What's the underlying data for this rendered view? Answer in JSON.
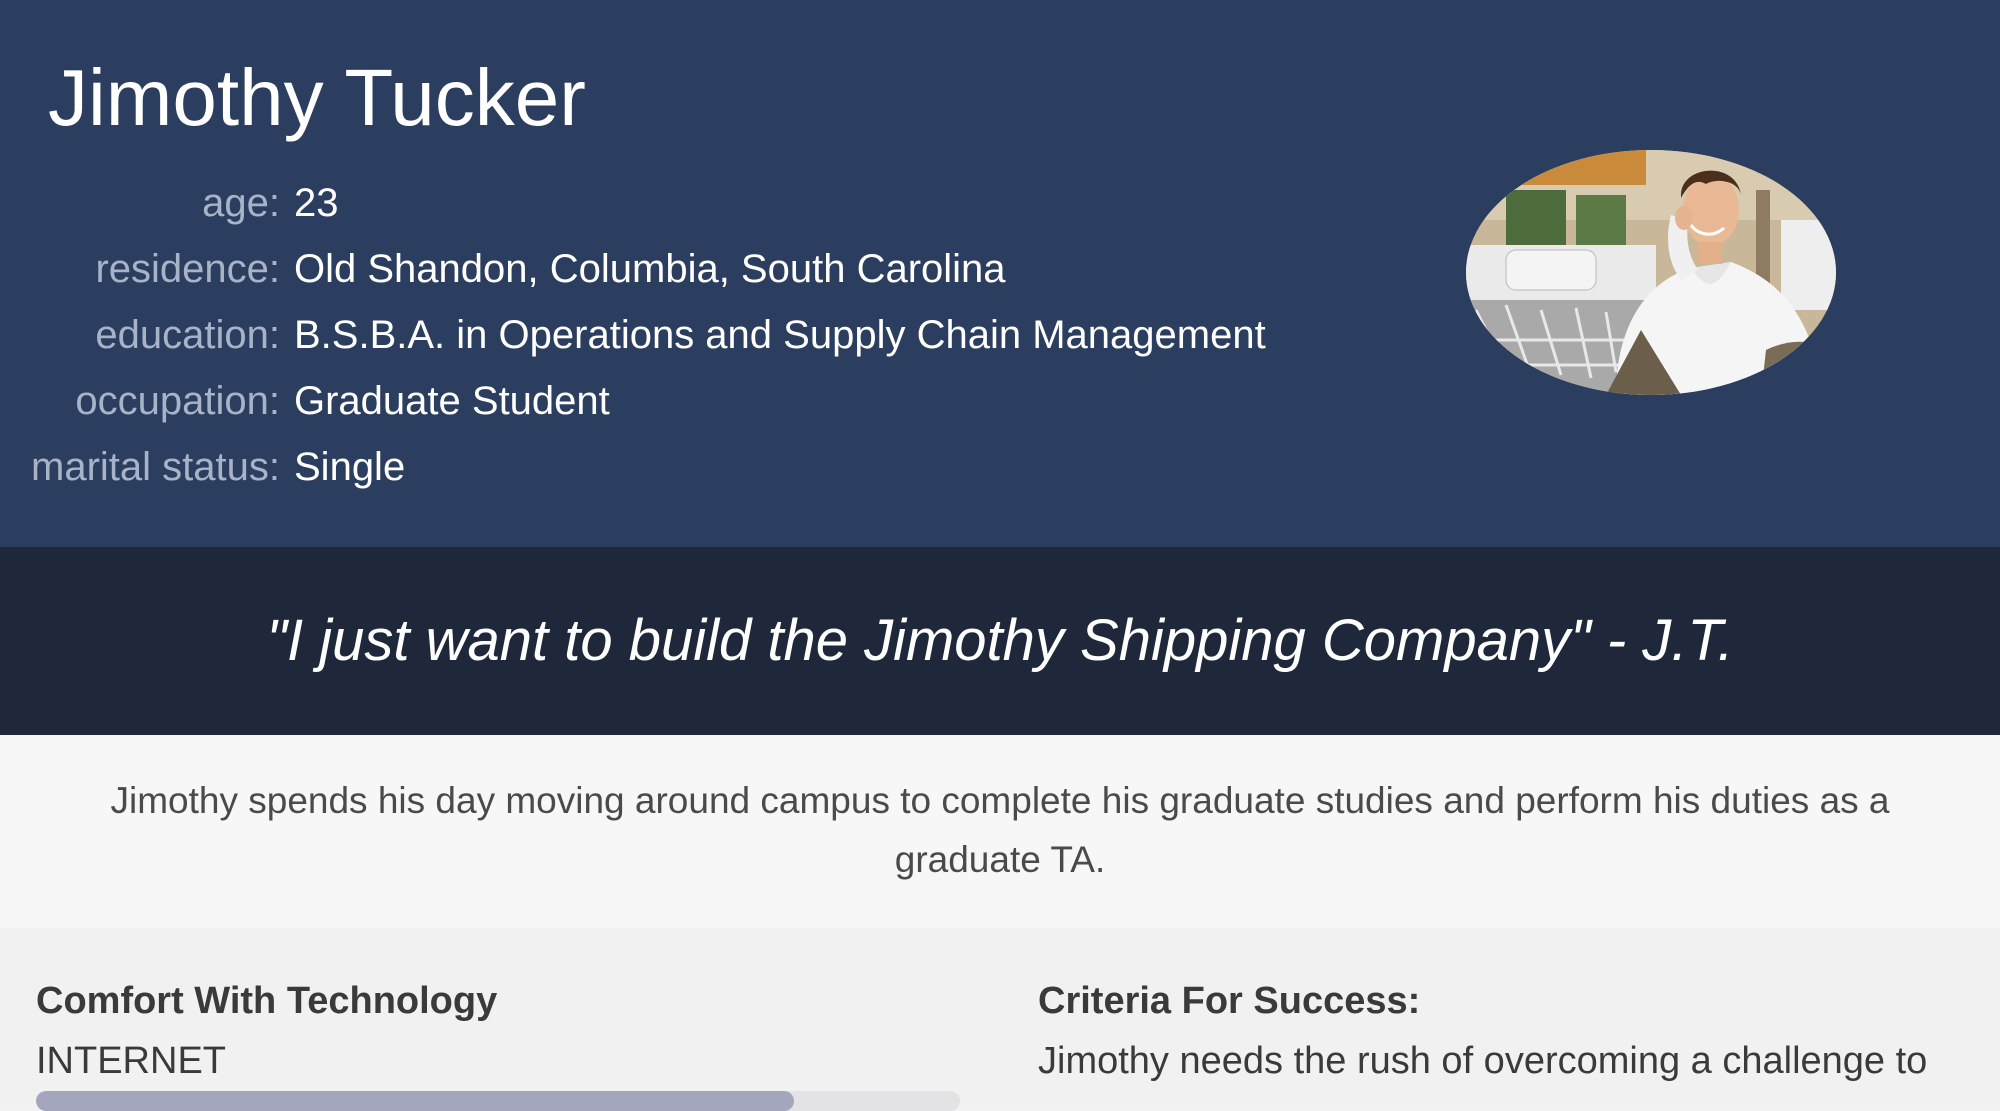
{
  "persona": {
    "name": "Jimothy Tucker",
    "details": [
      {
        "label": "age:",
        "value": "23"
      },
      {
        "label": "residence:",
        "value": "Old Shandon, Columbia, South Carolina"
      },
      {
        "label": "education:",
        "value": "B.S.B.A. in Operations and Supply Chain Management"
      },
      {
        "label": "occupation:",
        "value": "Graduate Student"
      },
      {
        "label": "marital status:",
        "value": "Single"
      }
    ],
    "photo_icon": "person-photo"
  },
  "quote": {
    "text": "\"I just want to build the Jimothy Shipping Company\" - J.T."
  },
  "summary": {
    "text": "Jimothy spends his day moving around campus to complete his graduate studies and perform his duties as a graduate TA."
  },
  "technology": {
    "title": "Comfort With Technology",
    "items": [
      {
        "label": "INTERNET",
        "level_percent": 82
      }
    ]
  },
  "success": {
    "title": "Criteria For Success:",
    "text": "Jimothy needs the rush of overcoming a challenge to"
  },
  "colors": {
    "header_bg": "#2c3e5f",
    "quote_bg": "#1e283a",
    "summary_bg": "#f7f7f8",
    "bar_fill": "#a3a6bd"
  }
}
